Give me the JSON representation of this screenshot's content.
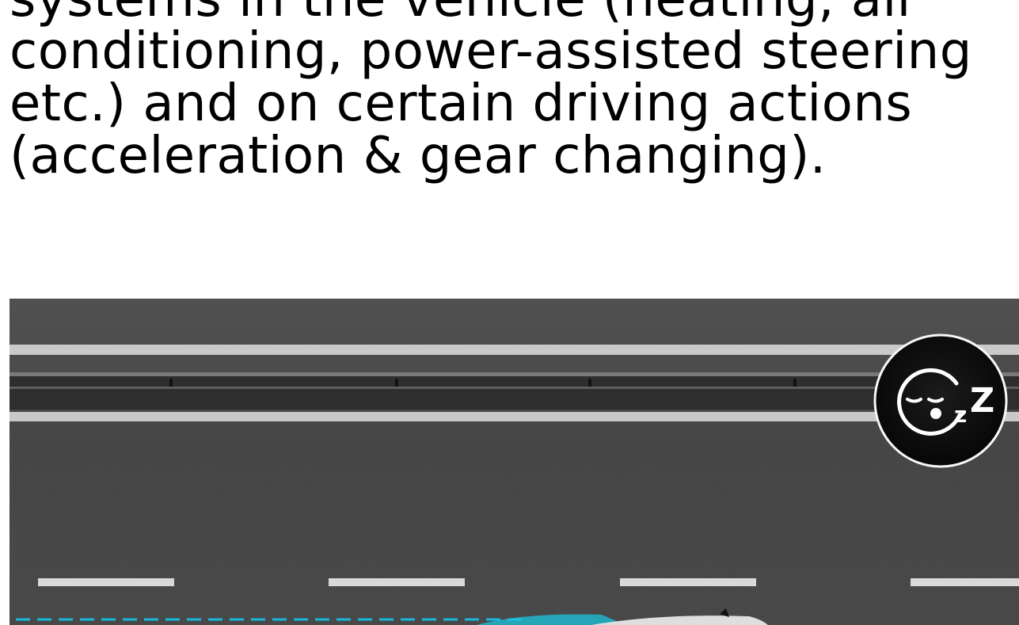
{
  "article": {
    "lines": [
      "systems in the vehicle (heating, air",
      "conditioning, power-assisted steering",
      "etc.) and on certain driving actions",
      "(acceleration & gear changing)."
    ]
  },
  "illustration": {
    "icon": "drowsy-driver-alert-icon",
    "colors": {
      "asphalt": "#4a4a4a",
      "lane_marking": "#d9d9d9",
      "guardrail": "#2f2f2f",
      "lane_assist_line": "#17b7d8",
      "icon_circle": "#111111",
      "icon_outline": "#ffffff"
    }
  }
}
